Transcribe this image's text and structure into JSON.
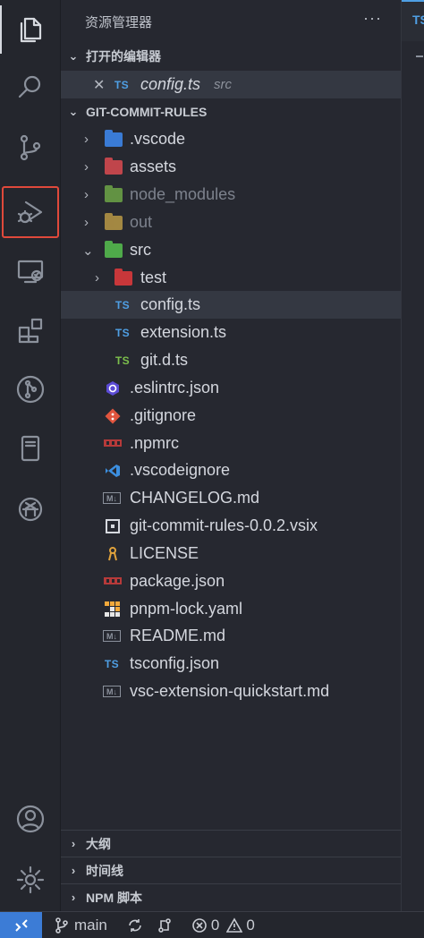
{
  "sidebar": {
    "title": "资源管理器",
    "more": "···",
    "open_editors_header": "打开的编辑器",
    "open_editor": {
      "close": "✕",
      "icon": "TS",
      "name": "config.ts",
      "desc": "src"
    },
    "project_header": "GIT-COMMIT-RULES",
    "tree": [
      {
        "label": ".vscode",
        "type": "folder",
        "color": "#3a7bd5"
      },
      {
        "label": "assets",
        "type": "folder",
        "color": "#c0454b"
      },
      {
        "label": "node_modules",
        "type": "folder",
        "color": "#7cbf4c"
      },
      {
        "label": "out",
        "type": "folder",
        "color": "#d9b04a"
      },
      {
        "label": "src",
        "type": "folder",
        "color": "#4faa4a"
      },
      {
        "label": "test",
        "type": "folder",
        "color": "#c8373a"
      },
      {
        "label": "config.ts",
        "icon": "TS"
      },
      {
        "label": "extension.ts",
        "icon": "TS"
      },
      {
        "label": "git.d.ts",
        "icon": "TS"
      },
      {
        "label": ".eslintrc.json",
        "icon": "eslint"
      },
      {
        "label": ".gitignore",
        "icon": "git"
      },
      {
        "label": ".npmrc",
        "icon": "npm"
      },
      {
        "label": ".vscodeignore",
        "icon": "vscode"
      },
      {
        "label": "CHANGELOG.md",
        "icon": "M↓"
      },
      {
        "label": "git-commit-rules-0.0.2.vsix",
        "icon": "vsix"
      },
      {
        "label": "LICENSE",
        "icon": "license"
      },
      {
        "label": "package.json",
        "icon": "npm"
      },
      {
        "label": "pnpm-lock.yaml",
        "icon": "pnpm"
      },
      {
        "label": "README.md",
        "icon": "M↓"
      },
      {
        "label": "tsconfig.json",
        "icon": "TS"
      },
      {
        "label": "vsc-extension-quickstart.md",
        "icon": "M↓"
      }
    ],
    "bottom_sections": [
      "大纲",
      "时间线",
      "NPM 脚本"
    ]
  },
  "editor_strip": {
    "tab_text": "TS"
  },
  "status_bar": {
    "remote_icon": "remote-icon",
    "branch": "main",
    "errors": "0",
    "warnings": "0"
  },
  "activity_bar": {
    "icons": [
      "explorer-icon",
      "search-icon",
      "source-control-icon",
      "run-debug-icon",
      "remote-explorer-icon",
      "extensions-icon",
      "git-graph-icon",
      "notebook-icon",
      "openai-icon",
      "account-icon",
      "settings-gear-icon"
    ]
  },
  "colors": {
    "highlight_box": "#e0493b",
    "accent": "#3c7cd6",
    "ts_blue": "#4f9fe4"
  }
}
